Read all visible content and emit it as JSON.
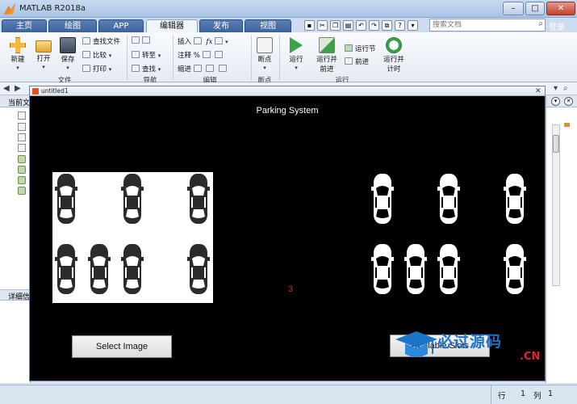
{
  "window": {
    "title": "MATLAB R2018a",
    "min": "–",
    "max": "□",
    "close": "✕"
  },
  "tabs": [
    "主页",
    "绘图",
    "APP",
    "编辑器",
    "发布",
    "视图"
  ],
  "active_tab": "编辑器",
  "search": {
    "placeholder": "搜索文档"
  },
  "login": "登录",
  "ribbon": {
    "file": {
      "new": "新建",
      "open": "打开",
      "save": "保存",
      "find_file": "查找文件",
      "compare": "比较",
      "print": "打印",
      "label": "文件"
    },
    "nav": {
      "goto": "转至",
      "find": "查找",
      "label": "导航"
    },
    "edit": {
      "insert": "插入",
      "comment": "注释",
      "indent": "缩进",
      "label": "编辑"
    },
    "bp": {
      "breakpoints": "断点",
      "label": "断点"
    },
    "run": {
      "run": "运行",
      "run_advance": "运行并",
      "run_advance2": "前进",
      "run_section": "运行节",
      "advance": "前进",
      "run_time": "运行并",
      "run_time2": "计时",
      "label": "运行"
    }
  },
  "left_panel": {
    "current_folder": "当前文",
    "details": "详细信"
  },
  "figure": {
    "window_title": "untitled1",
    "title": "Parking System",
    "slot_count": "3",
    "select_button": "Select Image",
    "available_button": "Available Slots"
  },
  "watermark": {
    "text": "必过源码",
    "suffix": ".CN"
  },
  "status": {
    "row_label": "行",
    "row": "1",
    "col_label": "列",
    "col": "1"
  },
  "parking": {
    "input_cars": [
      {
        "slot": 1,
        "row": 1
      },
      {
        "slot": 3,
        "row": 1
      },
      {
        "slot": 5,
        "row": 1
      },
      {
        "slot": 1,
        "row": 2
      },
      {
        "slot": 2,
        "row": 2
      },
      {
        "slot": 3,
        "row": 2
      },
      {
        "slot": 5,
        "row": 2
      }
    ],
    "output_cars": [
      {
        "slot": 1,
        "row": 1
      },
      {
        "slot": 3,
        "row": 1
      },
      {
        "slot": 5,
        "row": 1
      },
      {
        "slot": 1,
        "row": 2
      },
      {
        "slot": 2,
        "row": 2
      },
      {
        "slot": 3,
        "row": 2
      },
      {
        "slot": 5,
        "row": 2
      }
    ]
  }
}
